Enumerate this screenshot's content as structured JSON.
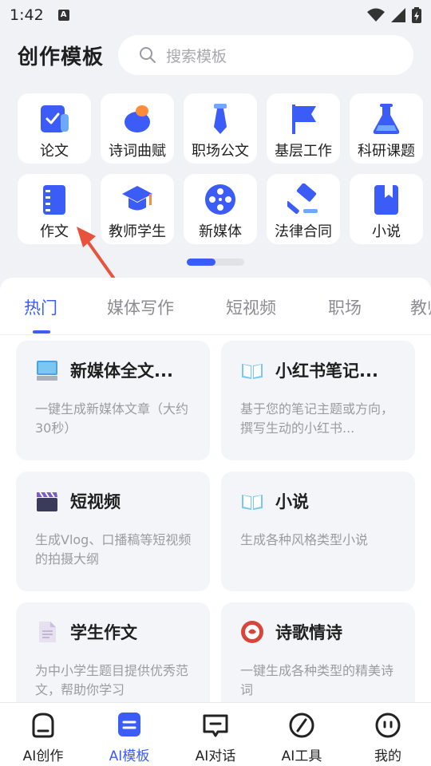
{
  "status_bar": {
    "time": "1:42",
    "indicator": "A"
  },
  "header": {
    "title": "创作模板",
    "search_placeholder": "搜索模板"
  },
  "categories": [
    {
      "label": "论文",
      "icon": "paper-check-icon"
    },
    {
      "label": "诗词曲赋",
      "icon": "leaf-icon"
    },
    {
      "label": "职场公文",
      "icon": "tie-icon"
    },
    {
      "label": "基层工作",
      "icon": "flag-icon"
    },
    {
      "label": "科研课题",
      "icon": "flask-icon"
    },
    {
      "label": "作文",
      "icon": "notebook-icon"
    },
    {
      "label": "教师学生",
      "icon": "graduation-cap-icon"
    },
    {
      "label": "新媒体",
      "icon": "film-reel-icon"
    },
    {
      "label": "法律合同",
      "icon": "gavel-icon"
    },
    {
      "label": "小说",
      "icon": "book-bookmark-icon"
    }
  ],
  "carousel": {
    "page_count": 2,
    "active_page": 1
  },
  "tabs": [
    {
      "label": "热门",
      "active": true
    },
    {
      "label": "媒体写作"
    },
    {
      "label": "短视频"
    },
    {
      "label": "职场"
    },
    {
      "label": "教师"
    }
  ],
  "cards": [
    {
      "title": "新媒体全文...",
      "desc": "一键生成新媒体文章（大约30秒）",
      "icon": "monitor-icon"
    },
    {
      "title": "小红书笔记...",
      "desc": "基于您的笔记主题或方向，撰写生动的小红书...",
      "icon": "open-book-icon"
    },
    {
      "title": "短视频",
      "desc": "生成Vlog、口播稿等短视频的拍摄大纲",
      "icon": "clapperboard-icon"
    },
    {
      "title": "小说",
      "desc": "生成各种风格类型小说",
      "icon": "open-book-icon"
    },
    {
      "title": "学生作文",
      "desc": "为中小学生题目提供优秀范文，帮助你学习",
      "icon": "document-icon"
    },
    {
      "title": "诗歌情诗",
      "desc": "一键生成各种类型的精美诗词",
      "icon": "poem-badge-icon"
    }
  ],
  "bottom_nav": [
    {
      "label": "AI创作",
      "icon": "create-icon"
    },
    {
      "label": "AI模板",
      "icon": "template-icon",
      "active": true
    },
    {
      "label": "AI对话",
      "icon": "chat-icon"
    },
    {
      "label": "AI工具",
      "icon": "compass-tool-icon"
    },
    {
      "label": "我的",
      "icon": "profile-face-icon"
    }
  ],
  "colors": {
    "accent": "#3b5cf6",
    "background": "#f1f2f6",
    "card": "#f4f5f8",
    "annotation_arrow": "#e8533b"
  }
}
